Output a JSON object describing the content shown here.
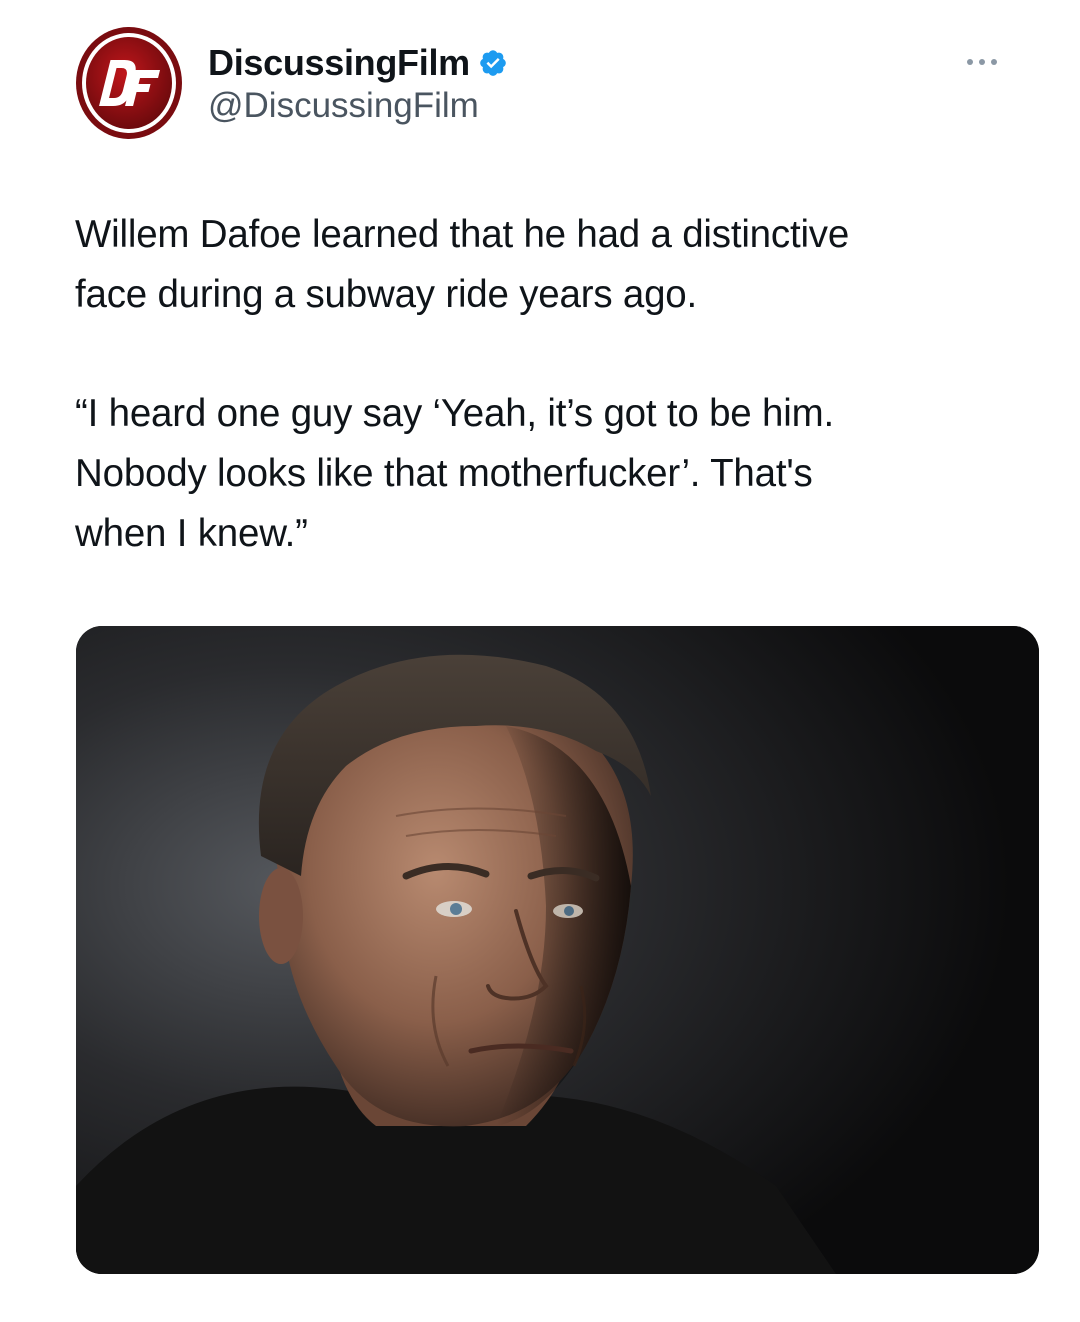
{
  "tweet": {
    "author": {
      "display_name": "DiscussingFilm",
      "handle": "@DiscussingFilm",
      "verified": true,
      "verified_icon": "verified-badge-icon",
      "avatar_icon": "discussingfilm-logo",
      "avatar_colors": {
        "ring": "#ffffff",
        "fill": "#9b1115",
        "glyph": "#ffffff"
      }
    },
    "more_icon": "more-options-icon",
    "text": {
      "paragraph1": [
        "Willem Dafoe learned that he had a distinctive",
        "face during a subway ride years ago."
      ],
      "paragraph2": [
        "“I heard one guy say ‘Yeah, it’s got to be him.",
        "Nobody looks like that motherfucker’. That's",
        "when I knew.”"
      ]
    },
    "media": {
      "type": "photo",
      "background_colors": [
        "#4a4d52",
        "#0b0b0c"
      ]
    },
    "colors": {
      "text": "#0f1419",
      "secondary_text": "#4a5560",
      "verified_blue": "#1d9bf0",
      "background": "#ffffff"
    }
  }
}
